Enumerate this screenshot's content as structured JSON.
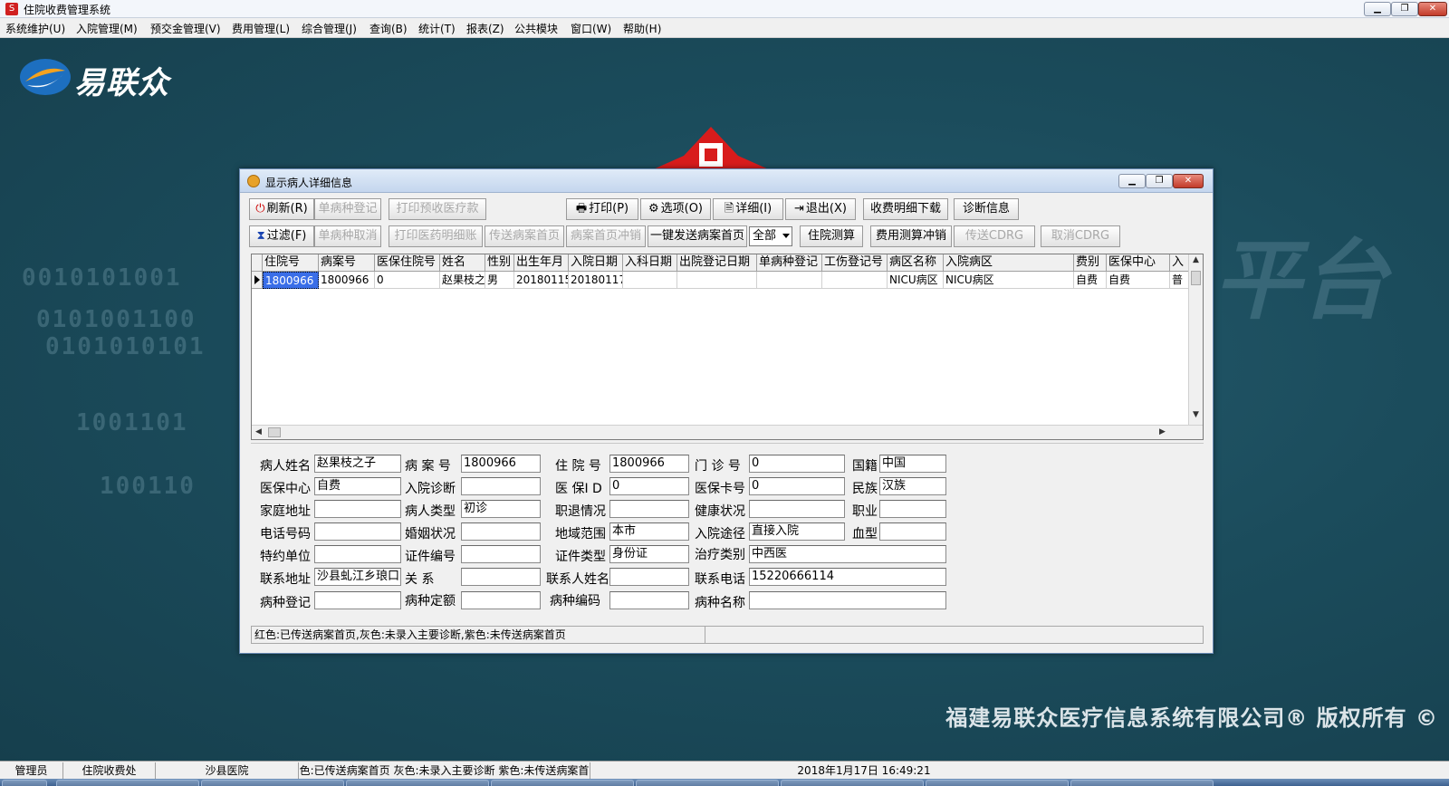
{
  "app": {
    "title": "住院收费管理系统",
    "menu": [
      "系统维护(U)",
      "入院管理(M)",
      "预交金管理(V)",
      "费用管理(L)",
      "综合管理(J)",
      "查询(B)",
      "统计(T)",
      "报表(Z)",
      "公共模块",
      "窗口(W)",
      "帮助(H)"
    ]
  },
  "desktop": {
    "logo_text": "易联众",
    "copyright": "福建易联众医疗信息系统有限公司® 版权所有 ©",
    "watermark_binary": [
      "0010101001",
      "0101001100",
      "0101010101",
      "1001101",
      "100110"
    ],
    "watermark_text": "平台"
  },
  "dialog": {
    "title": "显示病人详细信息",
    "toolbar1": {
      "refresh": "刷新(R)",
      "single_disease_register": "单病种登记",
      "print_prepay": "打印预收医疗款",
      "print": "打印(P)",
      "options": "选项(O)",
      "detail": "详细(I)",
      "exit": "退出(X)",
      "fee_download": "收费明细下载",
      "diagnosis": "诊断信息"
    },
    "toolbar2": {
      "filter": "过滤(F)",
      "single_disease_cancel": "单病种取消",
      "print_drug_detail": "打印医药明细账",
      "send_record_home": "传送病案首页",
      "record_home_reverse": "病案首页冲销",
      "one_click_send": "一键发送病案首页",
      "scope_select": "全部",
      "hospital_calc": "住院测算",
      "fee_calc_reverse": "费用测算冲销",
      "send_cdrg": "传送CDRG",
      "cancel_cdrg": "取消CDRG"
    },
    "grid": {
      "columns": [
        "住院号",
        "病案号",
        "医保住院号",
        "姓名",
        "性别",
        "出生年月",
        "入院日期",
        "入科日期",
        "出院登记日期",
        "单病种登记",
        "工伤登记号",
        "病区名称",
        "入院病区",
        "费别",
        "医保中心",
        "入"
      ],
      "rows": [
        [
          "1800966",
          "1800966",
          "0",
          "赵果枝之",
          "男",
          "20180115",
          "20180117",
          "",
          "",
          "",
          "",
          "NICU病区",
          "NICU病区",
          "自费",
          "自费",
          "普"
        ]
      ]
    },
    "form": {
      "patient_name_label": "病人姓名",
      "patient_name": "赵果枝之子",
      "record_no_label": "病 案 号",
      "record_no": "1800966",
      "inpatient_no_label": "住 院 号",
      "inpatient_no": "1800966",
      "outpatient_no_label": "门 诊 号",
      "outpatient_no": "0",
      "nationality_label": "国籍",
      "nationality": "中国",
      "insurance_center_label": "医保中心",
      "insurance_center": "自费",
      "admit_diag_label": "入院诊断",
      "admit_diag": "",
      "insurance_id_label": "医 保I D",
      "insurance_id": "0",
      "insurance_card_label": "医保卡号",
      "insurance_card": "0",
      "ethnicity_label": "民族",
      "ethnicity": "汉族",
      "home_address_label": "家庭地址",
      "home_address": "",
      "patient_type_label": "病人类型",
      "patient_type": "初诊",
      "retirement_label": "职退情况",
      "retirement": "",
      "health_label": "健康状况",
      "health": "",
      "occupation_label": "职业",
      "occupation": "",
      "phone_label": "电话号码",
      "phone": "",
      "marital_label": "婚姻状况",
      "marital": "",
      "region_label": "地域范围",
      "region": "本市",
      "admit_route_label": "入院途径",
      "admit_route": "直接入院",
      "blood_label": "血型",
      "blood": "",
      "contract_unit_label": "特约单位",
      "contract_unit": "",
      "cert_no_label": "证件编号",
      "cert_no": "",
      "cert_type_label": "证件类型",
      "cert_type": "身份证",
      "treatment_type_label": "治疗类别",
      "treatment_type": "中西医",
      "contact_addr_label": "联系地址",
      "contact_addr": "沙县虬江乡琅口",
      "relation_label": "关 系",
      "relation": "",
      "contact_name_label": "联系人姓名",
      "contact_name": "",
      "contact_phone_label": "联系电话",
      "contact_phone": "15220666114",
      "disease_reg_label": "病种登记",
      "disease_reg": "",
      "disease_quota_label": "病种定额",
      "disease_quota": "",
      "disease_code_label": "病种编码",
      "disease_code": "",
      "disease_name_label": "病种名称",
      "disease_name": ""
    },
    "status": "红色:已传送病案首页,灰色:未录入主要诊断,紫色:未传送病案首页"
  },
  "statusbar": {
    "user": "管理员",
    "department": "住院收费处",
    "hospital": "沙县医院",
    "legend": "色:已传送病案首页  灰色:未录入主要诊断  紫色:未传送病案首",
    "datetime": "2018年1月17日 16:49:21"
  },
  "colors": {
    "desktop_bg": "#1b4c5c",
    "selection": "#3a6ee8",
    "emblem_red": "#d81c1c"
  }
}
